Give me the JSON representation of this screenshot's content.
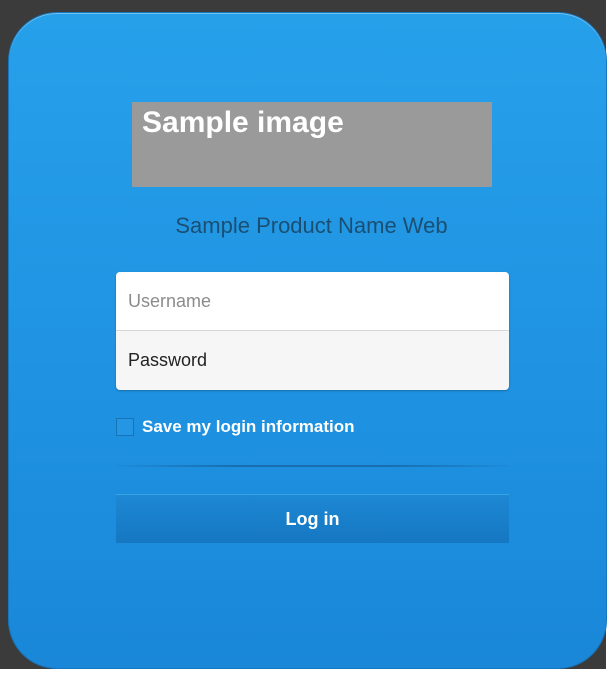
{
  "logo": {
    "text": "Sample image"
  },
  "product": {
    "name": "Sample Product Name Web"
  },
  "form": {
    "username_placeholder": "Username",
    "password_placeholder": "Password",
    "save_login_label": "Save my login information",
    "save_login_checked": false,
    "login_button_label": "Log in"
  },
  "colors": {
    "card_background": "#239BE6",
    "backdrop": "#3B3B3B",
    "product_name_text": "#1A4F73",
    "login_button": "#1677C2",
    "logo_placeholder": "#9A9A9A"
  },
  "icons": {
    "checkbox": "unchecked-checkbox-icon"
  }
}
